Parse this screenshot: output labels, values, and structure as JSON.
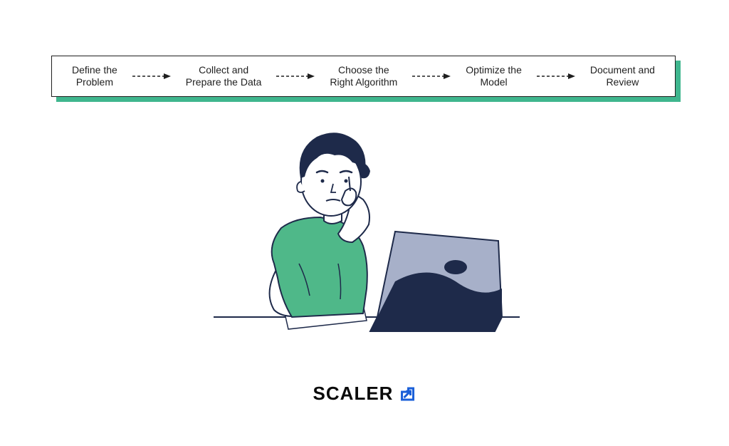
{
  "flow": {
    "steps": [
      "Define the\nProblem",
      "Collect and\nPrepare the Data",
      "Choose the\nRight Algorithm",
      "Optimize the\nModel",
      "Document and\nReview"
    ]
  },
  "brand": {
    "name": "SCALER"
  },
  "colors": {
    "accent_green": "#3fb68e",
    "dark_navy": "#1e2a4a",
    "light_bluegrey": "#a7b0c9",
    "brand_blue": "#1a5fd8",
    "ink": "#1f1f1f"
  }
}
